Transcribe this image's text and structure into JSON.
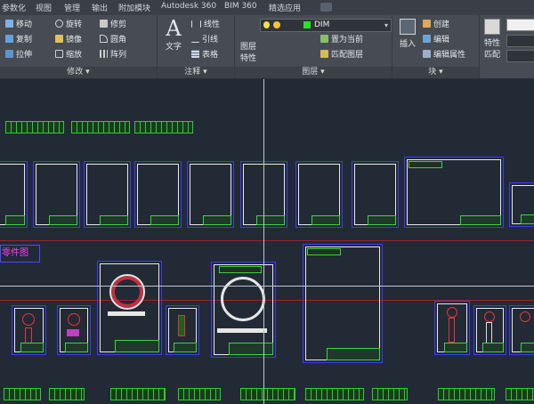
{
  "ribbon_tabs": [
    "参数化",
    "视图",
    "管理",
    "输出",
    "附加模块",
    "Autodesk 360",
    "BIM 360",
    "精选应用"
  ],
  "modify": {
    "title": "修改",
    "move": "移动",
    "rotate": "旋转",
    "trim": "修剪",
    "copy": "复制",
    "mirror": "镜像",
    "fillet": "圆角",
    "stretch": "拉伸",
    "scale": "缩放",
    "array": "阵列"
  },
  "annotation": {
    "title": "注释",
    "text": "文字",
    "linear": "线性",
    "leader": "引线",
    "table": "表格"
  },
  "layers": {
    "title": "图层",
    "properties_line1": "图层",
    "properties_line2": "特性",
    "current_layer": "DIM",
    "set_current": "置为当前",
    "match_layer": "匹配图层"
  },
  "block": {
    "title": "块",
    "insert": "插入",
    "create": "创建",
    "edit": "编辑",
    "edit_attributes": "编辑属性"
  },
  "properties": {
    "match_line1": "特性",
    "match_line2": "匹配"
  },
  "drawing": {
    "label": "零件图"
  },
  "colors": {
    "current_layer_swatch": "#2adf2a",
    "sheet_border": "#3b3bff",
    "title_block": "#3fd23f",
    "label_text": "#ff3cff"
  }
}
